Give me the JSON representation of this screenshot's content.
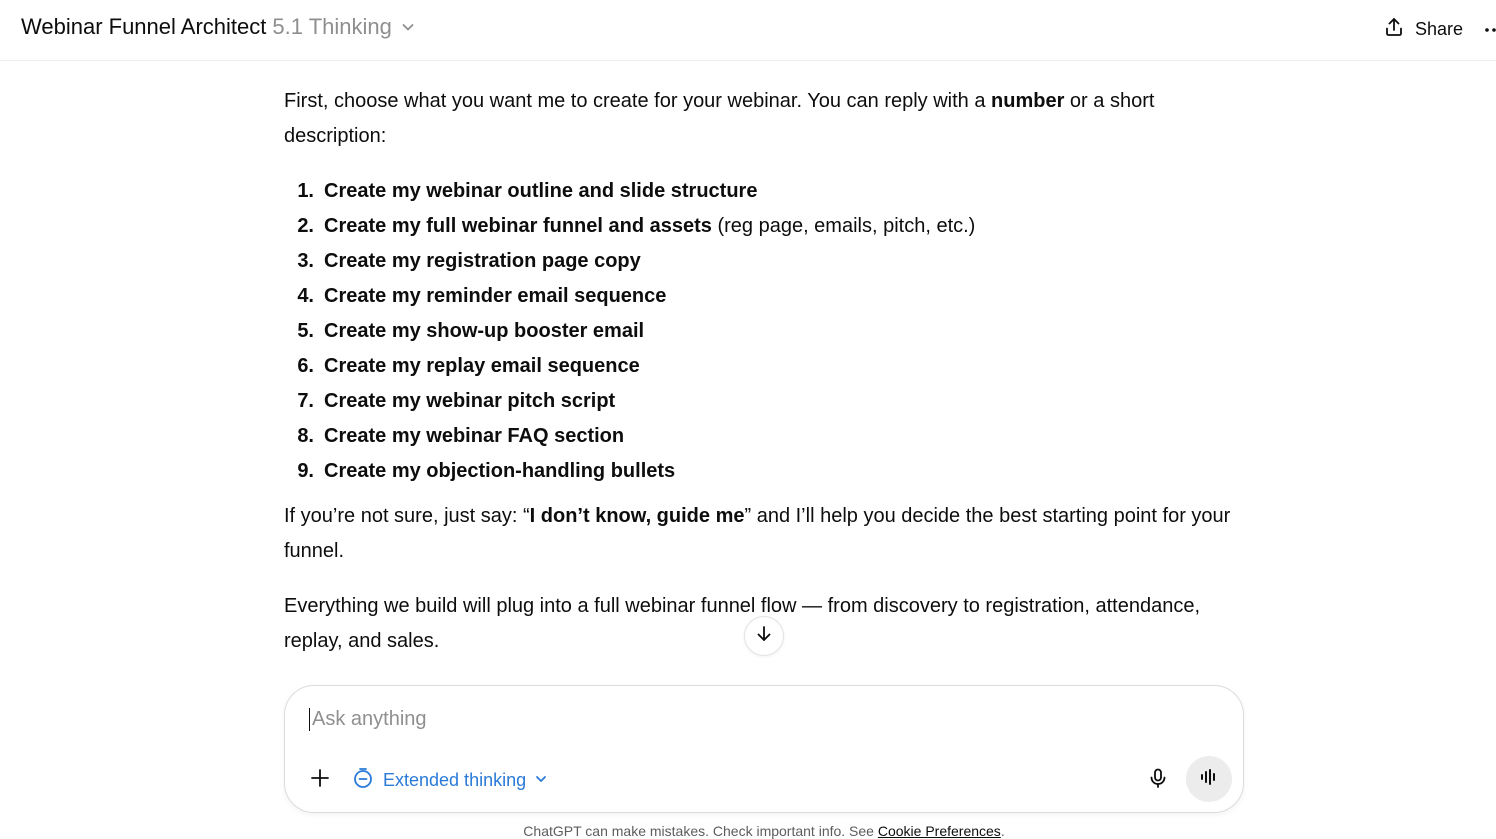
{
  "header": {
    "title": "Webinar Funnel Architect",
    "model": "5.1 Thinking",
    "share_label": "Share",
    "icons": {
      "model_dropdown": "chevron-down-icon",
      "share": "share-upload-icon",
      "more": "more-horizontal-icon"
    }
  },
  "message": {
    "intro_start": "First, choose what you want me to create for your webinar. You can reply with a ",
    "intro_bold": "number",
    "intro_end": " or a short description:",
    "items": [
      {
        "number": "1.",
        "bold": "Create my webinar outline and slide structure",
        "rest": ""
      },
      {
        "number": "2.",
        "bold": "Create my full webinar funnel and assets",
        "rest": " (reg page, emails, pitch, etc.)"
      },
      {
        "number": "3.",
        "bold": "Create my registration page copy",
        "rest": ""
      },
      {
        "number": "4.",
        "bold": "Create my reminder email sequence",
        "rest": ""
      },
      {
        "number": "5.",
        "bold": "Create my show-up booster email",
        "rest": ""
      },
      {
        "number": "6.",
        "bold": "Create my replay email sequence",
        "rest": ""
      },
      {
        "number": "7.",
        "bold": "Create my webinar pitch script",
        "rest": ""
      },
      {
        "number": "8.",
        "bold": "Create my webinar FAQ section",
        "rest": ""
      },
      {
        "number": "9.",
        "bold": "Create my objection-handling bullets",
        "rest": ""
      }
    ],
    "guide_start": "If you’re not sure, just say: “",
    "guide_bold": "I don’t know, guide me",
    "guide_end": "” and I’ll help you decide the best starting point for your funnel.",
    "closing": "Everything we build will plug into a full webinar funnel flow — from discovery to registration, attendance, replay, and sales."
  },
  "composer": {
    "placeholder": "Ask anything",
    "value": "",
    "mode_label": "Extended thinking",
    "icons": {
      "add": "plus-icon",
      "mode": "timer-icon",
      "mode_dropdown": "chevron-down-icon",
      "mic": "microphone-icon",
      "voice": "voice-waveform-icon",
      "scroll": "arrow-down-icon"
    }
  },
  "footer": {
    "disclaimer": "ChatGPT can make mistakes. Check important info. See ",
    "link_label": "Cookie Preferences",
    "end": "."
  },
  "colors": {
    "accent": "#2a7ad8",
    "text": "#0d0d0d",
    "muted": "#8f8f8f",
    "border": "#dcdcdc"
  }
}
